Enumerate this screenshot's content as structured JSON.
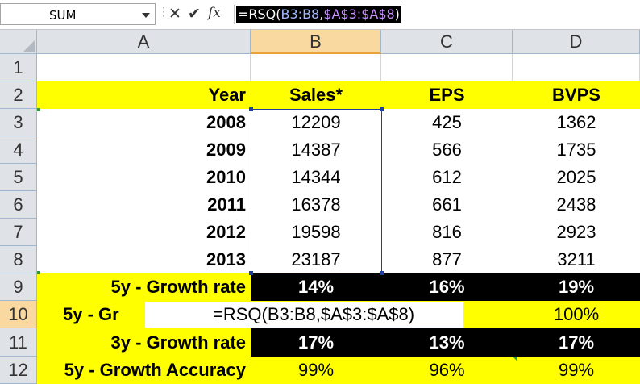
{
  "formula_bar": {
    "name_box": "SUM",
    "cancel_icon": "✕",
    "enter_icon": "✔",
    "fx_label": "fx",
    "formula_prefix": "=RSQ(",
    "formula_ref1": "B3:B8",
    "formula_sep": ",",
    "formula_ref2": "$A$3:$A$8",
    "formula_suffix": ")"
  },
  "columns": [
    "A",
    "B",
    "C",
    "D"
  ],
  "rows": [
    "1",
    "2",
    "3",
    "4",
    "5",
    "6",
    "7",
    "8",
    "9",
    "10",
    "11",
    "12"
  ],
  "headers": {
    "year": "Year",
    "sales": "Sales*",
    "eps": "EPS",
    "bvps": "BVPS"
  },
  "data_rows": [
    {
      "year": "2008",
      "sales": "12209",
      "eps": "425",
      "bvps": "1362"
    },
    {
      "year": "2009",
      "sales": "14387",
      "eps": "566",
      "bvps": "1735"
    },
    {
      "year": "2010",
      "sales": "14344",
      "eps": "612",
      "bvps": "2025"
    },
    {
      "year": "2011",
      "sales": "16378",
      "eps": "661",
      "bvps": "2438"
    },
    {
      "year": "2012",
      "sales": "19598",
      "eps": "816",
      "bvps": "2923"
    },
    {
      "year": "2013",
      "sales": "23187",
      "eps": "877",
      "bvps": "3211"
    }
  ],
  "summary": {
    "growth5_label": "5y - Growth rate",
    "growth5": {
      "sales": "14%",
      "eps": "16%",
      "bvps": "19%"
    },
    "row10_label_partial": "5y - Gr",
    "row10_edit_text": "=RSQ(B3:B8,$A$3:$A$8)",
    "row10_bvps": "100%",
    "growth3_label": "3y - Growth rate",
    "growth3": {
      "sales": "17%",
      "eps": "13%",
      "bvps": "17%"
    },
    "accuracy_label": "5y - Growth Accuracy",
    "accuracy": {
      "sales": "99%",
      "eps": "96%",
      "bvps": "99%"
    }
  },
  "icons": {
    "namebox_dropdown": "chevron-down-icon",
    "cancel": "close-icon",
    "enter": "check-icon",
    "function": "function-icon"
  },
  "colors": {
    "highlight": "#ffff00",
    "dark_cell": "#000000",
    "header_bg": "#dfe3e8",
    "selected_header": "#f9d99f",
    "range_border": "#1f3f9e"
  }
}
